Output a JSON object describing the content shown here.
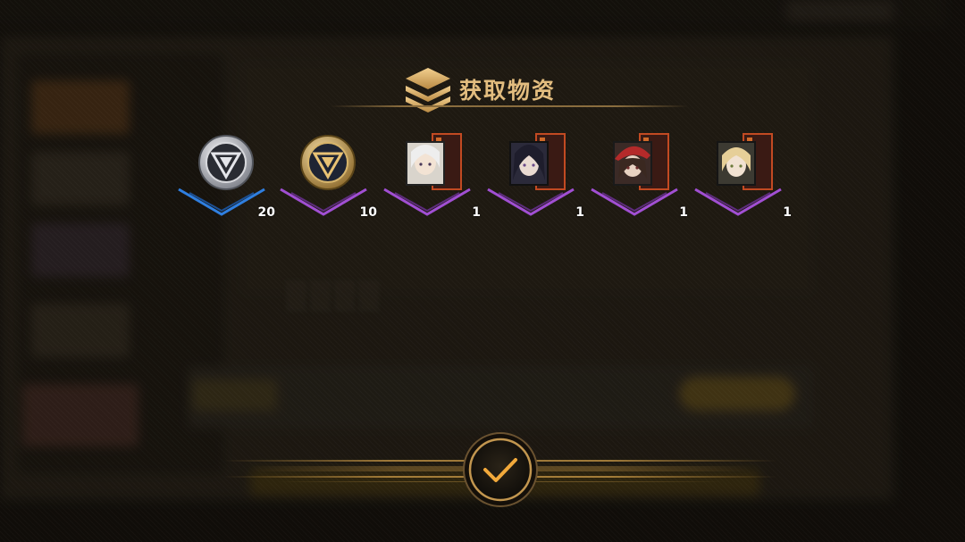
{
  "dialog": {
    "title": "获取物资",
    "title_icon": "stacked-layers-icon",
    "confirm_icon": "checkmark-icon"
  },
  "rewards": [
    {
      "name": "silver-token",
      "count": "20",
      "rarity_color": "#2f7fe0"
    },
    {
      "name": "gold-token",
      "count": "10",
      "rarity_color": "#a14fd3"
    },
    {
      "name": "character-card-white-hair",
      "count": "1",
      "rarity_color": "#a14fd3"
    },
    {
      "name": "character-card-dark-hair",
      "count": "1",
      "rarity_color": "#a14fd3"
    },
    {
      "name": "character-card-red-hat",
      "count": "1",
      "rarity_color": "#a14fd3"
    },
    {
      "name": "character-card-blonde",
      "count": "1",
      "rarity_color": "#a14fd3"
    }
  ],
  "colors": {
    "accent_gold": "#e3bd7f",
    "rarity_blue": "#2f7fe0",
    "rarity_purple": "#a14fd3",
    "confirm_check": "#f2a93b"
  }
}
